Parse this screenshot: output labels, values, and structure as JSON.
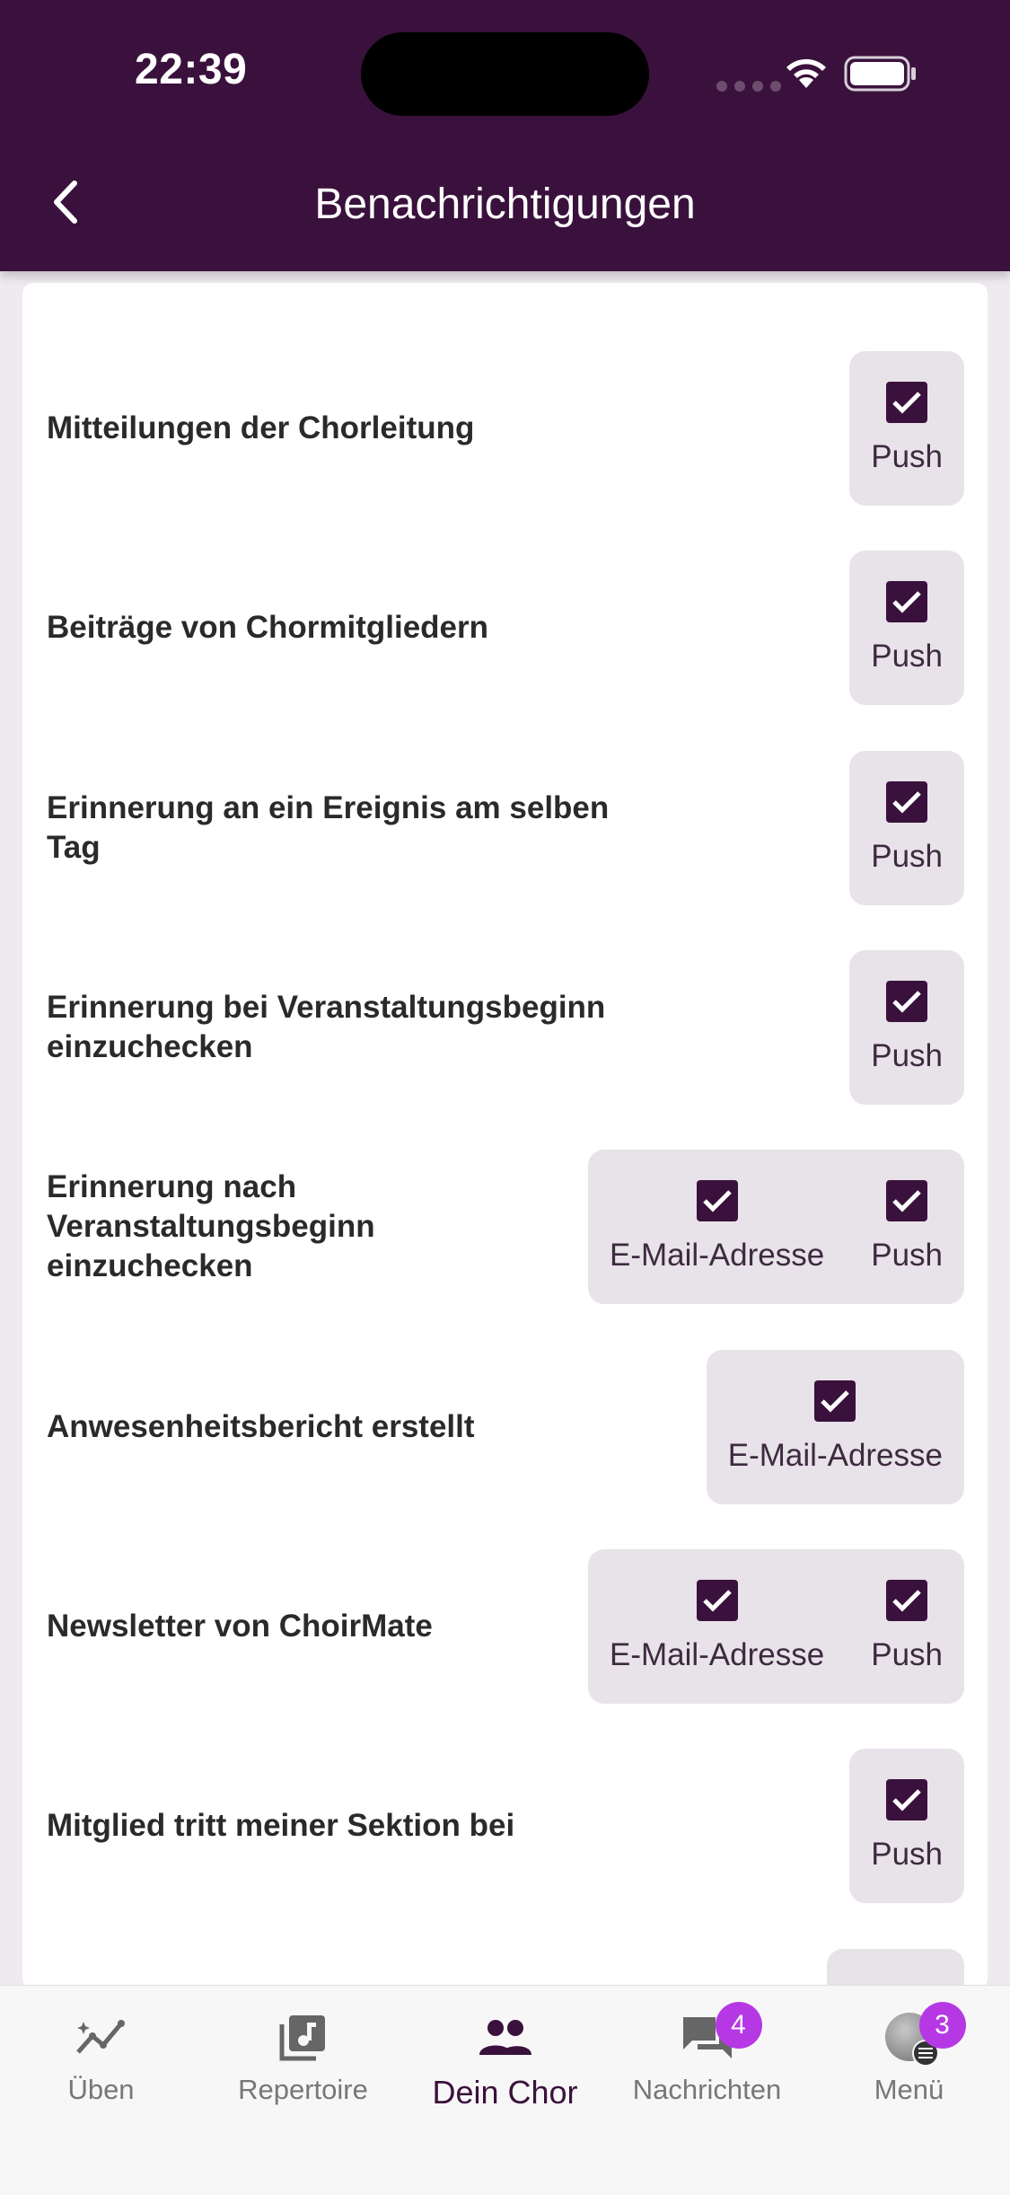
{
  "status_bar": {
    "time": "22:39"
  },
  "header": {
    "title": "Benachrichtigungen"
  },
  "rows": [
    {
      "label": "Mitteilungen der Chorleitung",
      "options": [
        {
          "label": "Push",
          "checked": true
        }
      ]
    },
    {
      "label": "Beiträge von Chormitgliedern",
      "options": [
        {
          "label": "Push",
          "checked": true
        }
      ]
    },
    {
      "label": "Erinnerung an ein Ereignis am selben Tag",
      "options": [
        {
          "label": "Push",
          "checked": true
        }
      ]
    },
    {
      "label": "Erinnerung bei Veranstaltungsbeginn einzuchecken",
      "options": [
        {
          "label": "Push",
          "checked": true
        }
      ]
    },
    {
      "label": "Erinnerung nach Veranstaltungsbeginn einzuchecken",
      "options": [
        {
          "label": "E-Mail-Adresse",
          "checked": true
        },
        {
          "label": "Push",
          "checked": true
        }
      ]
    },
    {
      "label": "Anwesenheitsbericht erstellt",
      "options": [
        {
          "label": "E-Mail-Adresse",
          "checked": true
        }
      ]
    },
    {
      "label": "Newsletter von ChoirMate",
      "options": [
        {
          "label": "E-Mail-Adresse",
          "checked": true
        },
        {
          "label": "Push",
          "checked": true
        }
      ]
    },
    {
      "label": "Mitglied tritt meiner Sektion bei",
      "options": [
        {
          "label": "Push",
          "checked": true
        }
      ]
    }
  ],
  "tabbar": {
    "tabs": [
      {
        "label": "Üben",
        "icon": "practice-chart-icon"
      },
      {
        "label": "Repertoire",
        "icon": "music-library-icon"
      },
      {
        "label": "Dein Chor",
        "icon": "group-icon",
        "active": true
      },
      {
        "label": "Nachrichten",
        "icon": "chat-icon",
        "badge": "4"
      },
      {
        "label": "Menü",
        "icon": "avatar-menu-icon",
        "badge": "3"
      }
    ]
  },
  "colors": {
    "primary": "#3a113c",
    "badge": "#b638e5",
    "option_bg": "#e8e2e9"
  }
}
